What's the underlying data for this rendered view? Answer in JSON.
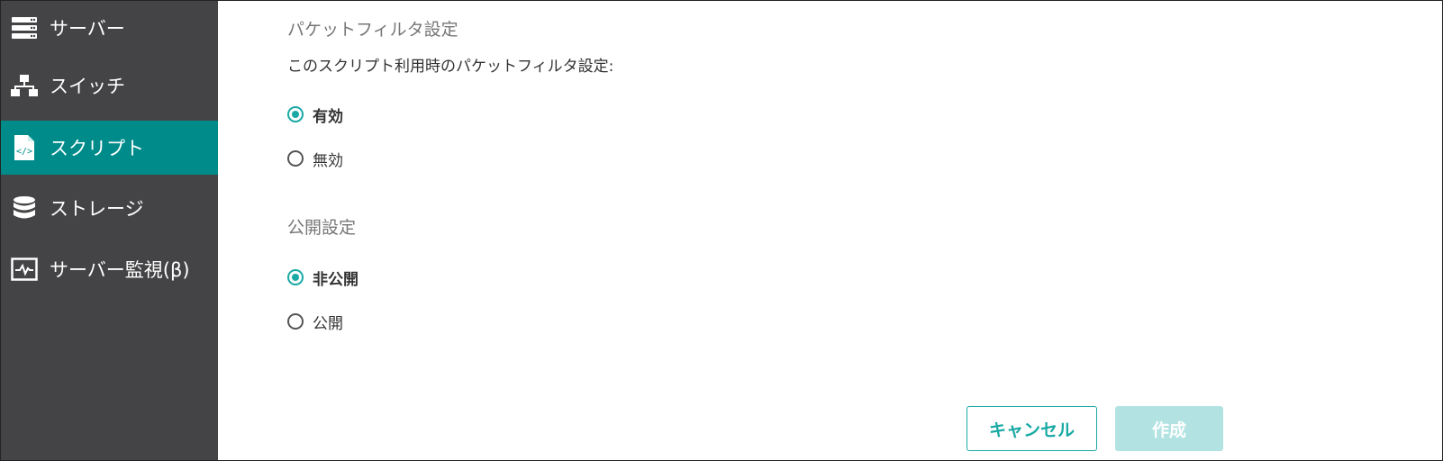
{
  "sidebar": {
    "items": [
      {
        "label": "サーバー",
        "icon": "server-icon",
        "active": false
      },
      {
        "label": "スイッチ",
        "icon": "network-switch-icon",
        "active": false
      },
      {
        "label": "スクリプト",
        "icon": "script-file-icon",
        "active": true
      },
      {
        "label": "ストレージ",
        "icon": "storage-database-icon",
        "active": false
      },
      {
        "label": "サーバー監視(β)",
        "icon": "monitor-pulse-icon",
        "active": false
      }
    ]
  },
  "form": {
    "packet_filter": {
      "title": "パケットフィルタ設定",
      "description": "このスクリプト利用時のパケットフィルタ設定:",
      "options": [
        {
          "label": "有効",
          "selected": true
        },
        {
          "label": "無効",
          "selected": false
        }
      ]
    },
    "visibility": {
      "title": "公開設定",
      "options": [
        {
          "label": "非公開",
          "selected": true
        },
        {
          "label": "公開",
          "selected": false
        }
      ]
    }
  },
  "actions": {
    "cancel_label": "キャンセル",
    "create_label": "作成"
  },
  "colors": {
    "sidebar_bg": "#444446",
    "active_bg": "#008b8b",
    "accent": "#1aa9a4",
    "disabled_button": "#b2e3e2"
  }
}
